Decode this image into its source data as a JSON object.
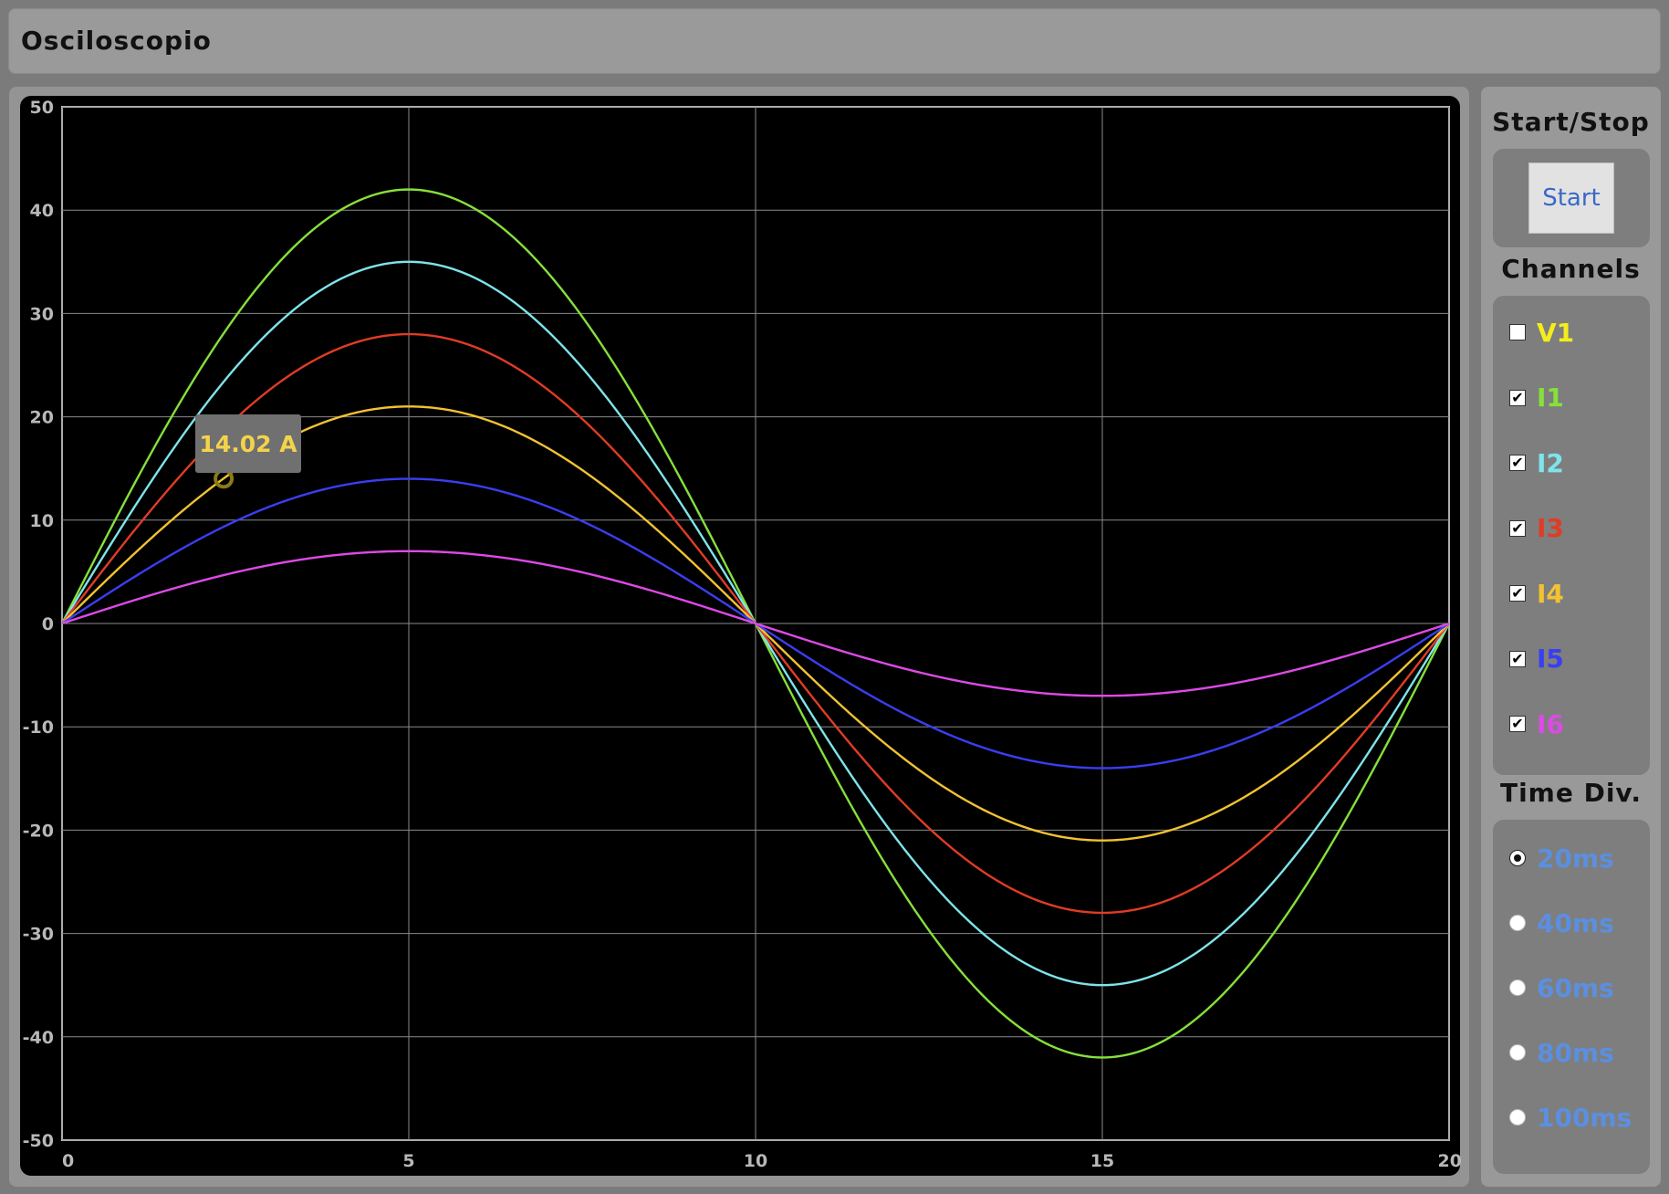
{
  "window": {
    "title": "Osciloscopio"
  },
  "controls": {
    "start_stop_title": "Start/Stop",
    "start_label": "Start",
    "channels_title": "Channels",
    "channels": [
      {
        "label": "V1",
        "checked": false,
        "color": "#f4ec1c"
      },
      {
        "label": "I1",
        "checked": true,
        "color": "#86e03a"
      },
      {
        "label": "I2",
        "checked": true,
        "color": "#7ee4ea"
      },
      {
        "label": "I3",
        "checked": true,
        "color": "#e03c25"
      },
      {
        "label": "I4",
        "checked": true,
        "color": "#f2c232"
      },
      {
        "label": "I5",
        "checked": true,
        "color": "#3a3ef2"
      },
      {
        "label": "I6",
        "checked": true,
        "color": "#dd4ae6"
      }
    ],
    "time_div_title": "Time Div.",
    "time_divs": [
      {
        "label": "20ms",
        "selected": true
      },
      {
        "label": "40ms",
        "selected": false
      },
      {
        "label": "60ms",
        "selected": false
      },
      {
        "label": "80ms",
        "selected": false
      },
      {
        "label": "100ms",
        "selected": false
      }
    ],
    "time_div_color": "#5b8fe0"
  },
  "tooltip": {
    "text": "14.02 A",
    "x": 2.33,
    "y": 14.02,
    "series": "I4"
  },
  "chart_data": {
    "type": "line",
    "xlim": [
      0,
      20
    ],
    "ylim": [
      -50,
      50
    ],
    "x_ticks": [
      0,
      5,
      10,
      15,
      20
    ],
    "y_ticks": [
      50,
      40,
      30,
      20,
      10,
      0,
      -10,
      -20,
      -30,
      -40,
      -50
    ],
    "grid": true,
    "waveform": "sine",
    "period": 20,
    "series": [
      {
        "name": "I1",
        "amplitude": 42,
        "color": "#86e03a"
      },
      {
        "name": "I2",
        "amplitude": 35,
        "color": "#7ee4ea"
      },
      {
        "name": "I3",
        "amplitude": 28,
        "color": "#e03c25"
      },
      {
        "name": "I4",
        "amplitude": 21,
        "color": "#f2c232"
      },
      {
        "name": "I5",
        "amplitude": 14,
        "color": "#3a3ef2"
      },
      {
        "name": "I6",
        "amplitude": 7,
        "color": "#dd4ae6"
      }
    ]
  }
}
